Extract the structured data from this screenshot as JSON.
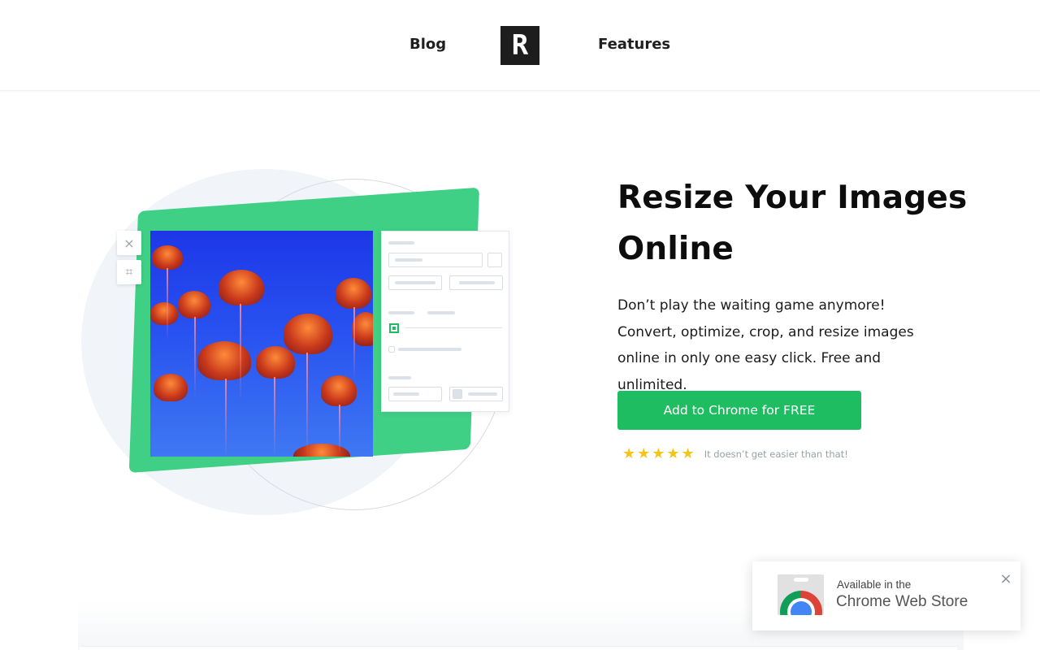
{
  "header": {
    "blog_label": "Blog",
    "logo_glyph": "R",
    "features_label": "Features"
  },
  "hero": {
    "title": "Resize Your Images Online",
    "description": "Don’t play the waiting game anymore! Convert, optimize, crop, and resize images online in only one easy click. Free and unlimited.",
    "cta_label": "Add to Chrome for FREE",
    "rating": {
      "stars": "★★★★★",
      "stars_count": 5,
      "text": "It doesn’t get easier than that!"
    }
  },
  "illustration": {
    "close_icon": "×",
    "crop_icon": "⌗"
  },
  "store_popup": {
    "small_text": "Available in the",
    "big_text": "Chrome Web Store",
    "close_icon": "×"
  },
  "colors": {
    "accent_green": "#1fbd62",
    "card_green": "#3fcf85",
    "star_yellow": "#f5c518"
  }
}
